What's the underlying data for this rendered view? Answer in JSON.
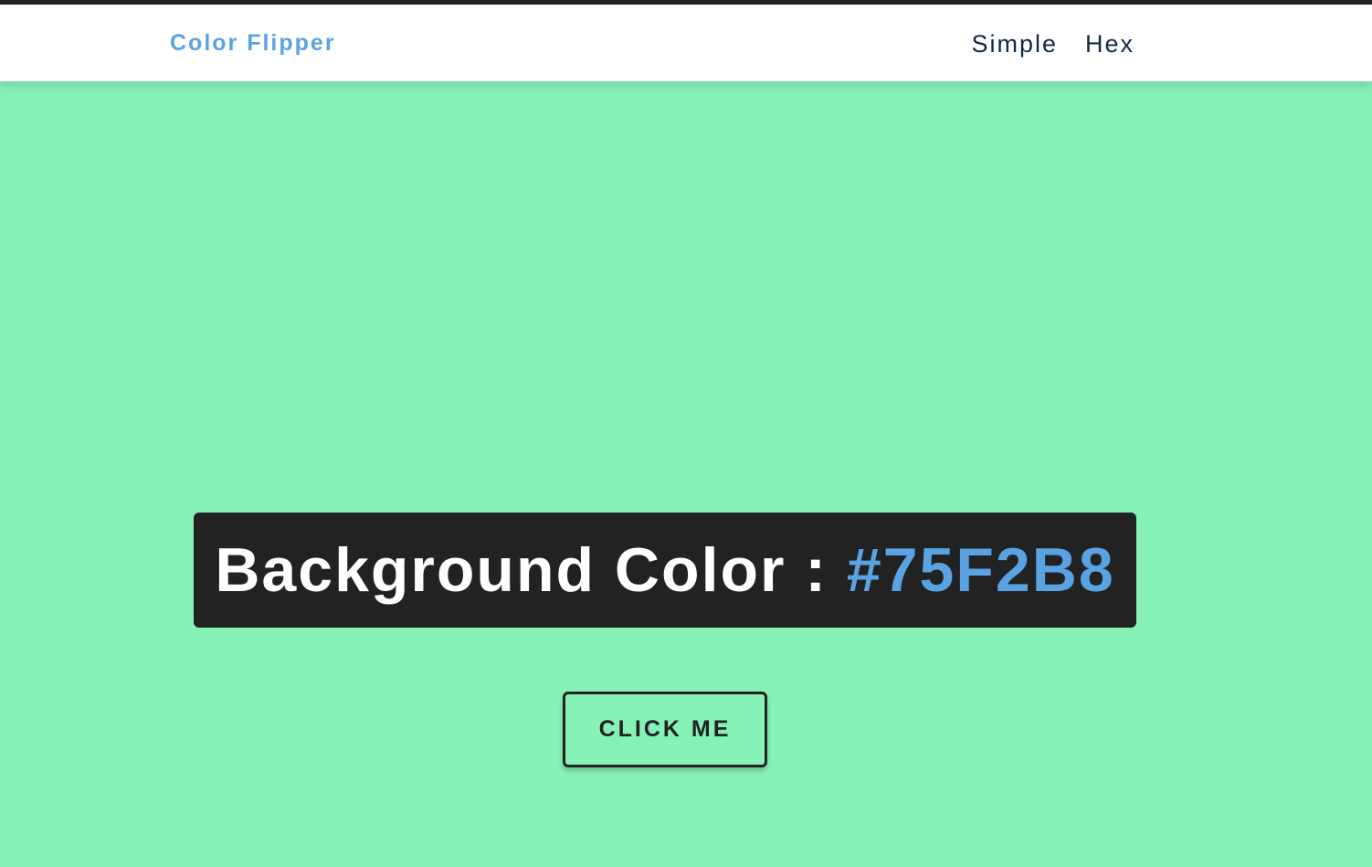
{
  "colors": {
    "background": "#87F2B8",
    "brand": "#5aa3e2",
    "nav_text": "#102a43",
    "banner_bg": "#222222",
    "banner_text": "#ffffff",
    "hex_value": "#5aa3e2"
  },
  "navbar": {
    "brand": "Color Flipper",
    "links": [
      {
        "label": "Simple"
      },
      {
        "label": "Hex"
      }
    ]
  },
  "main": {
    "banner_label": "Background Color : ",
    "banner_value": "#75F2B8",
    "button_label": "CLICK ME"
  }
}
